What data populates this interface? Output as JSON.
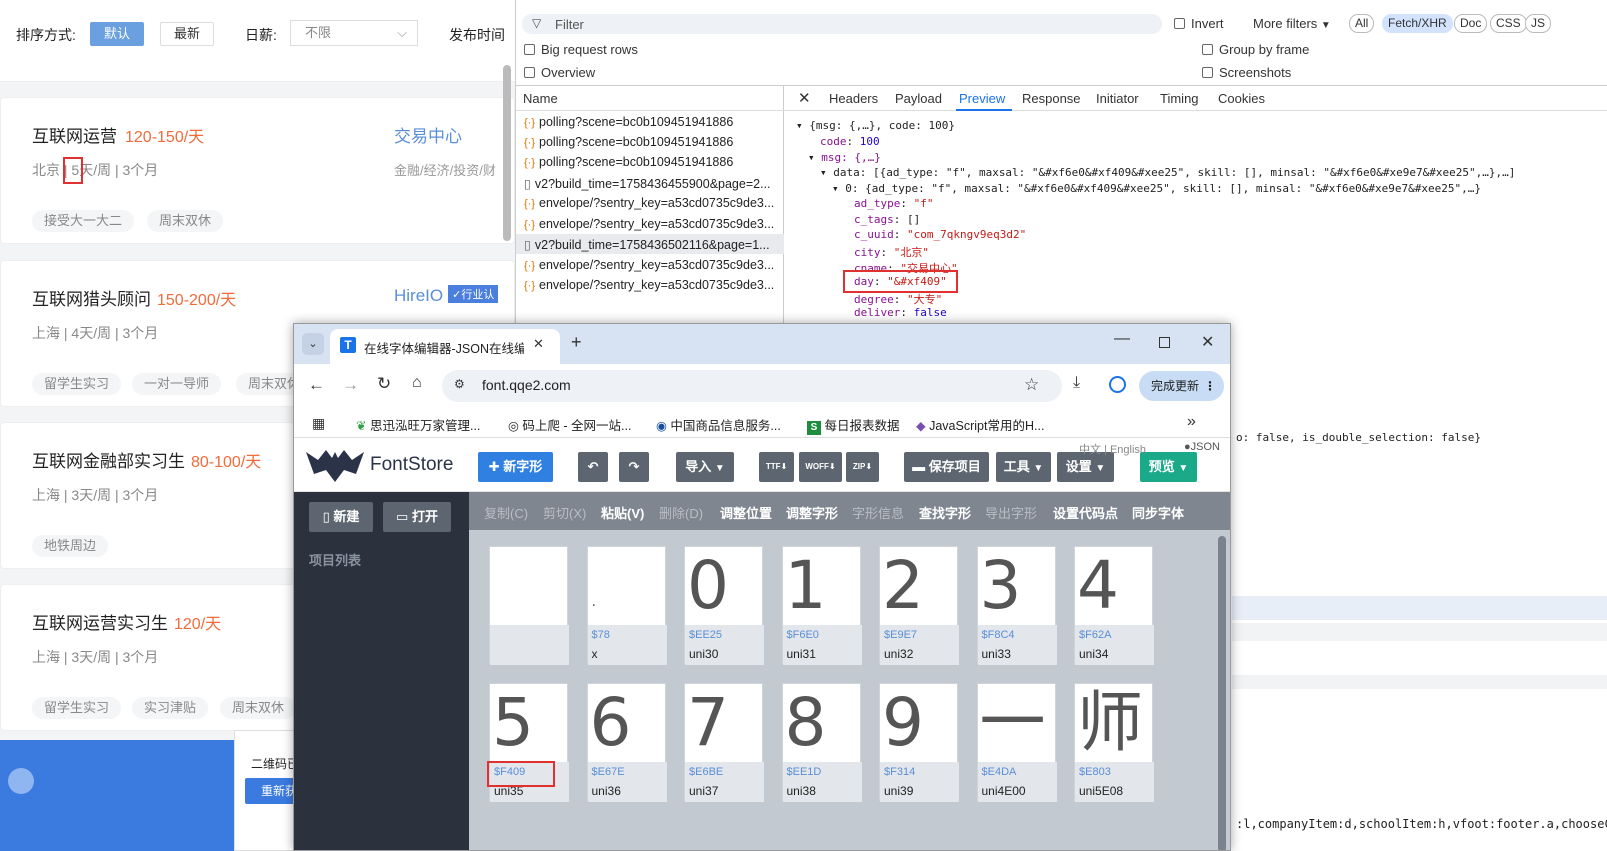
{
  "left": {
    "sort_label": "排序方式:",
    "sort_default": "默认",
    "sort_latest": "最新",
    "salary_label": "日薪:",
    "salary_value": "不限",
    "publish_label": "发布时间",
    "jobs": [
      {
        "title": "互联网运营",
        "salary": "120-150/天",
        "company": "交易中心",
        "city": "北京",
        "days": "5",
        "meta_rest": "天/周 | 3个月",
        "industry": "金融/经济/投资/财",
        "tags": [
          "接受大一大二",
          "周末双休"
        ]
      },
      {
        "title": "互联网猎头顾问",
        "salary": "150-200/天",
        "company": "HireIO",
        "badge": "行业认",
        "meta": "上海 | 4天/周 | 3个月",
        "tags": [
          "留学生实习",
          "一对一导师",
          "周末双休"
        ]
      },
      {
        "title": "互联网金融部实习生",
        "salary": "80-100/天",
        "meta": "上海 | 3天/周 | 3个月",
        "tags": [
          "地铁周边"
        ]
      },
      {
        "title": "互联网运营实习生",
        "salary": "120/天",
        "meta": "上海 | 3天/周 | 3个月",
        "tags": [
          "留学生实习",
          "实习津贴",
          "周末双休"
        ]
      }
    ],
    "qr_text": "二维码已",
    "qr_btn": "重新获"
  },
  "devtools": {
    "filter_placeholder": "Filter",
    "invert": "Invert",
    "more_filters": "More filters",
    "type_filters": [
      "All",
      "Fetch/XHR",
      "Doc",
      "CSS",
      "JS"
    ],
    "big_request_rows": "Big request rows",
    "overview": "Overview",
    "group_by_frame": "Group by frame",
    "screenshots": "Screenshots",
    "name_header": "Name",
    "requests": [
      "polling?scene=bc0b109451941886",
      "polling?scene=bc0b109451941886",
      "polling?scene=bc0b109451941886",
      "v2?build_time=1758436455900&page=2...",
      "envelope/?sentry_key=a53cd0735c9de3...",
      "envelope/?sentry_key=a53cd0735c9de3...",
      "v2?build_time=1758436502116&page=1...",
      "envelope/?sentry_key=a53cd0735c9de3...",
      "envelope/?sentry_key=a53cd0735c9de3..."
    ],
    "panel_tabs": [
      "Headers",
      "Payload",
      "Preview",
      "Response",
      "Initiator",
      "Timing",
      "Cookies"
    ],
    "json": {
      "l1": "{msg: {,…}, code: 100}",
      "code_key": "code",
      "code_val": "100",
      "msg_line": "msg: {,…}",
      "data_line": "data: [{ad_type: \"f\", maxsal: \"&#xf6e0&#xf409&#xee25\", skill: [], minsal: \"&#xf6e0&#xe9e7&#xee25\",…},…]",
      "zero_line": "0: {ad_type: \"f\", maxsal: \"&#xf6e0&#xf409&#xee25\", skill: [], minsal: \"&#xf6e0&#xe9e7&#xee25\",…}",
      "ad_type": "\"f\"",
      "c_tags": "[]",
      "c_uuid": "\"com_7qkngv9eq3d2\"",
      "city": "\"北京\"",
      "cname": "\"交易中心\"",
      "day": "\"&#xf409\"",
      "degree": "\"大专\"",
      "deliver": "false",
      "tail1": "o: false, is_double_selection: false}",
      "tail2": ":l,companyItem:d,schoolItem:h,vfoot:footer.a,chooseCityLaye"
    }
  },
  "browser": {
    "tab_title": "在线字体编辑器-JSON在线编辑",
    "url": "font.qqe2.com",
    "update_btn": "完成更新",
    "bookmarks": [
      "思迅泓旺万家管理...",
      "码上爬 - 全网一站...",
      "中国商品信息服务...",
      "每日报表数据",
      "JavaScript常用的H..."
    ],
    "fontstore": {
      "logo": "FontStore",
      "new_glyph": "新字形",
      "import": "导入",
      "save_project": "保存项目",
      "tools": "工具",
      "settings": "设置",
      "preview": "预览",
      "lang": "中文 | English",
      "json": "JSON",
      "btn_new": "新建",
      "btn_open": "打开",
      "project_list": "项目列表",
      "toolbar": [
        {
          "label": "复制(C)",
          "dis": true
        },
        {
          "label": "剪切(X)",
          "dis": true
        },
        {
          "label": "粘贴(V)",
          "dis": false
        },
        {
          "label": "删除(D)",
          "dis": true
        },
        {
          "label": "调整位置",
          "dis": false
        },
        {
          "label": "调整字形",
          "dis": false
        },
        {
          "label": "字形信息",
          "dis": true
        },
        {
          "label": "查找字形",
          "dis": false
        },
        {
          "label": "导出字形",
          "dis": true
        },
        {
          "label": "设置代码点",
          "dis": false
        },
        {
          "label": "同步字体",
          "dis": false
        }
      ],
      "glyphs": [
        {
          "ch": "",
          "code": "",
          "name": ""
        },
        {
          "ch": ".",
          "code": "$78",
          "name": "x"
        },
        {
          "ch": "0",
          "code": "$EE25",
          "name": "uni30"
        },
        {
          "ch": "1",
          "code": "$F6E0",
          "name": "uni31"
        },
        {
          "ch": "2",
          "code": "$E9E7",
          "name": "uni32"
        },
        {
          "ch": "3",
          "code": "$F8C4",
          "name": "uni33"
        },
        {
          "ch": "4",
          "code": "$F62A",
          "name": "uni34"
        },
        {
          "ch": "5",
          "code": "$F409",
          "name": "uni35"
        },
        {
          "ch": "6",
          "code": "$E67E",
          "name": "uni36"
        },
        {
          "ch": "7",
          "code": "$E6BE",
          "name": "uni37"
        },
        {
          "ch": "8",
          "code": "$EE1D",
          "name": "uni38"
        },
        {
          "ch": "9",
          "code": "$F314",
          "name": "uni39"
        },
        {
          "ch": "一",
          "code": "$E4DA",
          "name": "uni4E00"
        },
        {
          "ch": "师",
          "code": "$E803",
          "name": "uni5E08"
        }
      ]
    }
  },
  "colors": {
    "accent_blue": "#6a9fe0",
    "salary_orange": "#f26b3a",
    "highlight_red": "#e03030",
    "preview_green": "#1aaa8a",
    "new_blue": "#2f80e0"
  }
}
